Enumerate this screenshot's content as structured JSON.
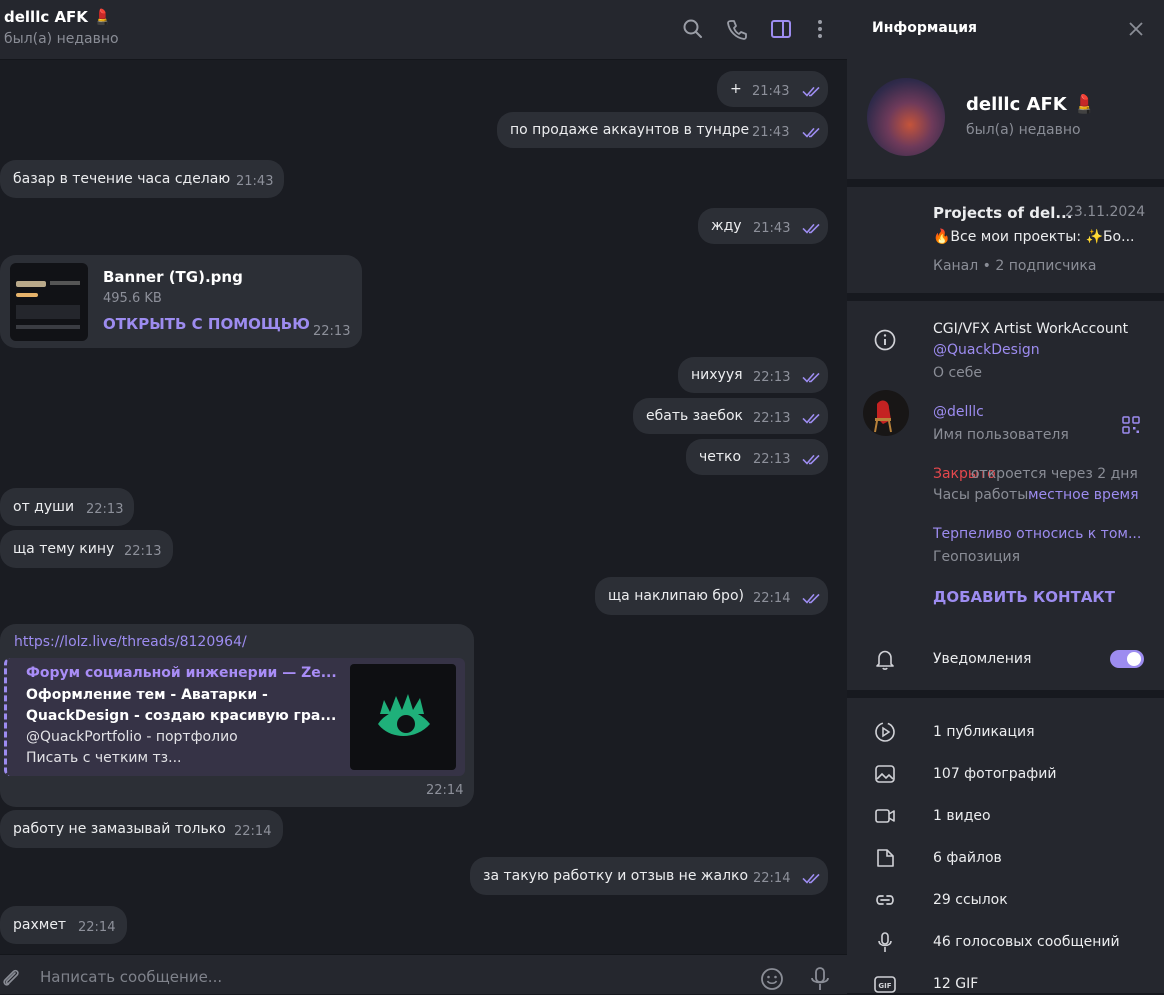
{
  "header": {
    "name": "delllc AFK 💄",
    "status": "был(а) недавно"
  },
  "messages": {
    "m1": {
      "text": "+",
      "time": "21:43"
    },
    "m2": {
      "text": "по продаже аккаунтов в тундре",
      "time": "21:43"
    },
    "m3": {
      "text": "базар в течение часа сделаю",
      "time": "21:43"
    },
    "m4": {
      "text": "жду",
      "time": "21:43"
    },
    "file": {
      "name": "Banner (TG).png",
      "size": "495.6 KB",
      "action": "ОТКРЫТЬ С ПОМОЩЬЮ",
      "time": "22:13"
    },
    "m5": {
      "text": "нихуyя",
      "time": "22:13"
    },
    "m6": {
      "text": "ебать заебок",
      "time": "22:13"
    },
    "m7": {
      "text": "четко",
      "time": "22:13"
    },
    "m8": {
      "text": "от души",
      "time": "22:13"
    },
    "m9": {
      "text": "ща тему кину",
      "time": "22:13"
    },
    "m10": {
      "text": "ща наклипаю бро)",
      "time": "22:14"
    },
    "link": {
      "url": "https://lolz.live/threads/8120964/",
      "site": "Форум социальной инженерии —  Ze...",
      "title1": "Оформление тем - Аватарки -",
      "title2": "QuackDesign - создаю красивую гра...",
      "desc1": "@QuackPortfolio - портфолио",
      "desc2": "Писать с четким тз...",
      "time": "22:14"
    },
    "m11": {
      "text": "работу не замазывай только",
      "time": "22:14"
    },
    "m12": {
      "text": "за такую работку и отзыв не жалко",
      "time": "22:14"
    },
    "m13": {
      "text": "рахмет",
      "time": "22:14"
    }
  },
  "composer": {
    "placeholder": "Написать сообщение..."
  },
  "panel": {
    "title": "Информация",
    "name": "delllc AFK 💄",
    "status": "был(а) недавно",
    "channel": {
      "name": "Projects of del...",
      "date": "23.11.2024",
      "preview": "🔥Все мои проекты:  ✨Бо...",
      "meta": "Канал • 2 подписчика"
    },
    "bio": {
      "line1": "CGI/VFX Artist WorkAccount",
      "line2": "@QuackDesign",
      "label": "О себе"
    },
    "username": {
      "value": "@delllc",
      "label": "Имя пользователя"
    },
    "hours": {
      "closed": "Закрыто",
      "opens": "откроется через 2 дня",
      "label": "Часы работы",
      "local": "местное время"
    },
    "geo": {
      "value": "Терпеливо относись к том...",
      "label": "Геопозиция"
    },
    "add_contact": "ДОБАВИТЬ КОНТАКТ",
    "notifications": {
      "label": "Уведомления",
      "enabled": true
    },
    "media": {
      "posts": "1 публикация",
      "photos": "107 фотографий",
      "videos": "1 видео",
      "files": "6 файлов",
      "links": "29 ссылок",
      "voice": "46 голосовых сообщений",
      "gif": "12 GIF"
    }
  },
  "colors": {
    "accent": "#9d8cf0",
    "bubble": "#2c2f36",
    "background": "#1a1c22",
    "panel": "#25272e",
    "closed": "#e5484d"
  }
}
